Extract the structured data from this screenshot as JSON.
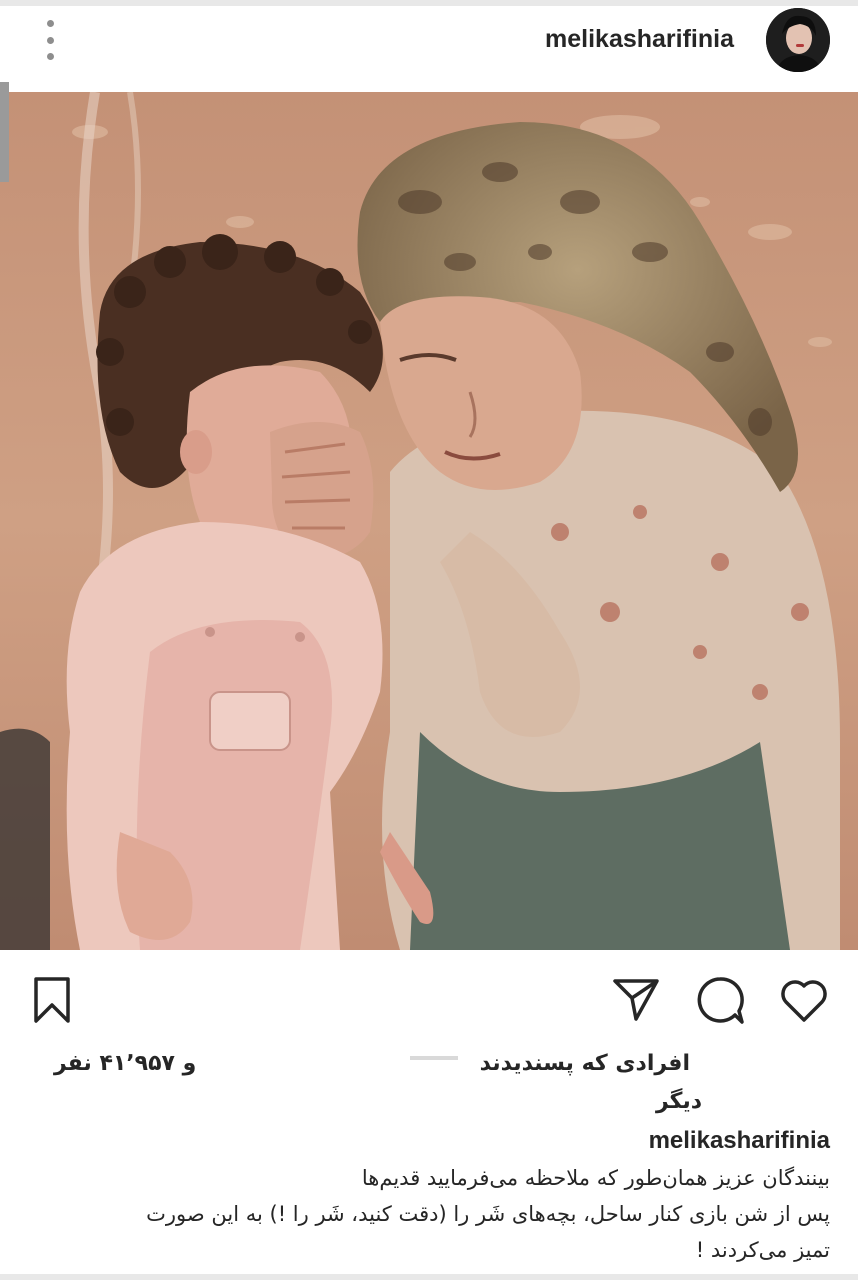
{
  "header": {
    "username": "melikasharifinia",
    "menu_icon": "more-vertical-icon",
    "avatar_icon": "profile-avatar"
  },
  "post": {
    "photo_description_icon": "post-photo",
    "actions": {
      "like_icon": "heart-icon",
      "comment_icon": "comment-icon",
      "share_icon": "send-icon",
      "save_icon": "bookmark-icon"
    },
    "likes": {
      "prefix": "افرادی که پسندیدند",
      "count_text": "و ۴۱٬۹۵۷ نفر",
      "suffix": "دیگر"
    },
    "caption": {
      "username": "melikasharifinia",
      "lines": [
        "بینندگان عزیز همان‌طور که ملاحظه می‌فرمایید قدیم‌ها",
        "پس از شن بازی کنار ساحل، بچه‌های شَر را (دقت کنید، شَر را !) به این صورت",
        "تمیز می‌کردند !"
      ]
    }
  },
  "colors": {
    "text": "#262626",
    "muted": "#8e8e8e",
    "photo_tone": "#c79c80"
  }
}
